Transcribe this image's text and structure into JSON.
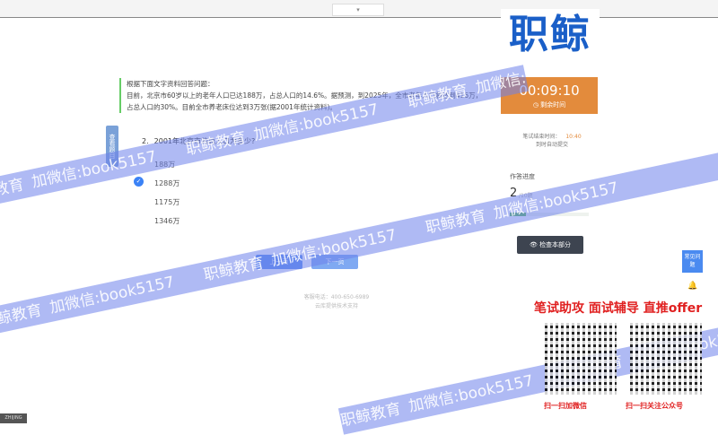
{
  "topbar": {
    "dropdown": "▾"
  },
  "logo": "职鲸",
  "material": {
    "title": "根据下面文字资料回答问题：",
    "text": "目前，北京市60岁以上的老年人口已达188万，占总人口的14.6%。据预测，到2025年，全市老年人口将达到416万，占总人口的30%。目前全市养老床位达到3万张(据2001年统计资料)。"
  },
  "side_tab": "查看题目",
  "question": {
    "number": "2.",
    "text": "2001年北京市的总人口为多少?",
    "options": [
      "188万",
      "1288万",
      "1175万",
      "1346万"
    ],
    "selected_index": 1
  },
  "nav": {
    "prev": "上一页",
    "next": "下一页"
  },
  "footer": {
    "line1": "客服电话：400-650-6989",
    "line2": "云库提供技术支持"
  },
  "timer": {
    "time": "00:09:10",
    "label": "剩余时间"
  },
  "end_info": {
    "label": "笔试结束时间：",
    "time": "10:40",
    "note": "到时自动提交"
  },
  "progress": {
    "label": "作答进度",
    "done": "2",
    "total": "/10题",
    "fraction": 0.2
  },
  "check_button": "检查本部分",
  "faq": "常见问题",
  "promo": {
    "headline": "笔试助攻  面试辅导  直推offer",
    "qr1_label": "扫一扫加微信",
    "qr2_label": "扫一扫关注公众号"
  },
  "watermark": "职鲸教育 加微信:book5157",
  "corner": "ZHIJING"
}
